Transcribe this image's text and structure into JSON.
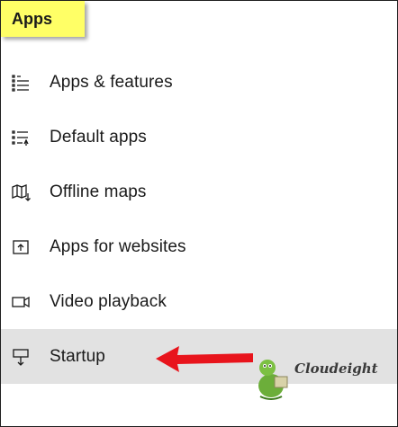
{
  "header": {
    "title": "Apps"
  },
  "nav": {
    "items": [
      {
        "label": "Apps & features",
        "icon": "apps-features-icon"
      },
      {
        "label": "Default apps",
        "icon": "default-apps-icon"
      },
      {
        "label": "Offline maps",
        "icon": "offline-maps-icon"
      },
      {
        "label": "Apps for websites",
        "icon": "apps-for-websites-icon"
      },
      {
        "label": "Video playback",
        "icon": "video-playback-icon"
      },
      {
        "label": "Startup",
        "icon": "startup-icon",
        "selected": true
      }
    ]
  },
  "annotation": {
    "arrow_color": "#e8141c",
    "watermark_text": "Cloudeight"
  },
  "colors": {
    "title_highlight": "#ffff66",
    "selected_row": "#e2e2e2"
  }
}
